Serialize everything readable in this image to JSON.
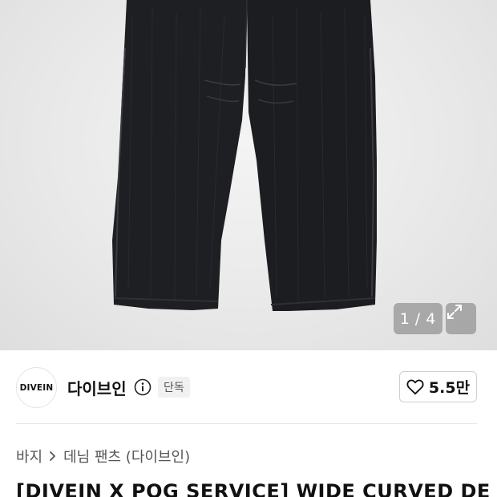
{
  "gallery": {
    "image_alt": "black wide curved denim pants",
    "current": "1",
    "separator": "/",
    "total": "4"
  },
  "brand": {
    "logo_text": "DIVEIN",
    "name": "다이브인",
    "badge": "단독"
  },
  "likes": {
    "count": "5.5만"
  },
  "breadcrumb": {
    "items": [
      "바지",
      "데님 팬츠 (다이브인)"
    ]
  },
  "product": {
    "title": "[DIVEIN X POG SERVICE] WIDE CURVED DE"
  },
  "colors": {
    "denim": "#1e1f22",
    "seam": "#3a3b3f",
    "background": "#e9e9e9"
  },
  "icons": [
    "expand-icon",
    "info-icon",
    "heart-icon",
    "chevron-right-icon"
  ]
}
